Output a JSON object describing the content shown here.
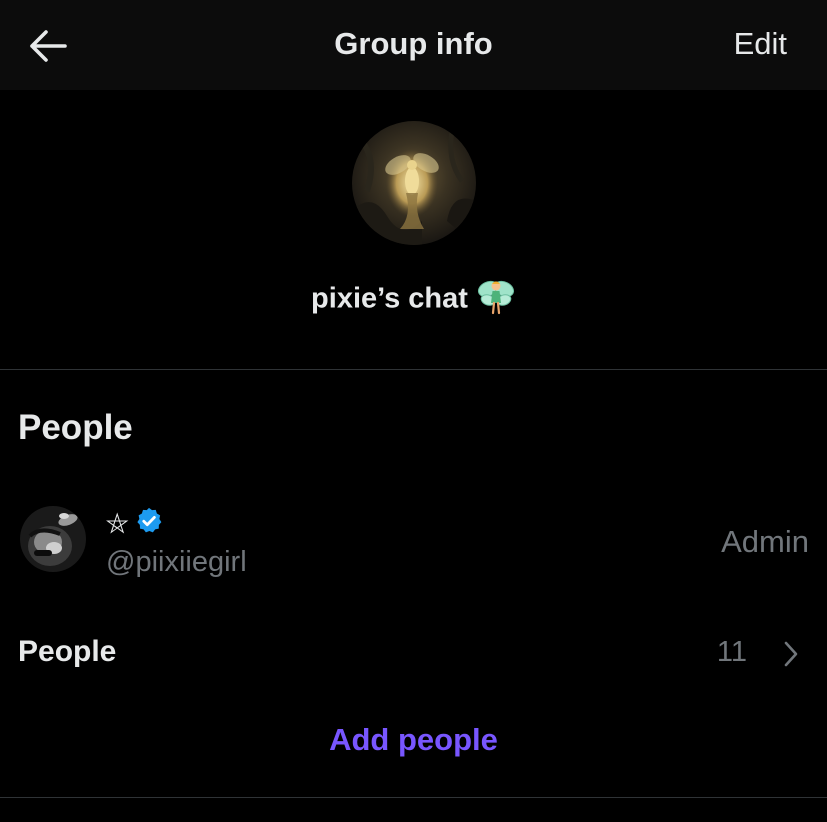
{
  "header": {
    "title": "Group info",
    "edit_label": "Edit",
    "back_icon": "arrow-left-icon"
  },
  "group": {
    "name": "pixie’s chat",
    "name_emoji": "🧚",
    "avatar": "fairy-forest-image"
  },
  "people_section": {
    "title": "People",
    "members": [
      {
        "display_name": "⛤",
        "verified": true,
        "handle": "@piixiiegirl",
        "role": "Admin",
        "avatar": "dark-portrait-image"
      }
    ],
    "people_row_label": "People",
    "people_count": "11",
    "add_people_label": "Add people"
  },
  "colors": {
    "background": "#000000",
    "header_background": "#0c0c0c",
    "text_primary": "#e7e9ea",
    "text_secondary": "#71767b",
    "accent": "#7856ff",
    "verified_blue": "#1d9bf0",
    "divider": "#2f3336"
  }
}
